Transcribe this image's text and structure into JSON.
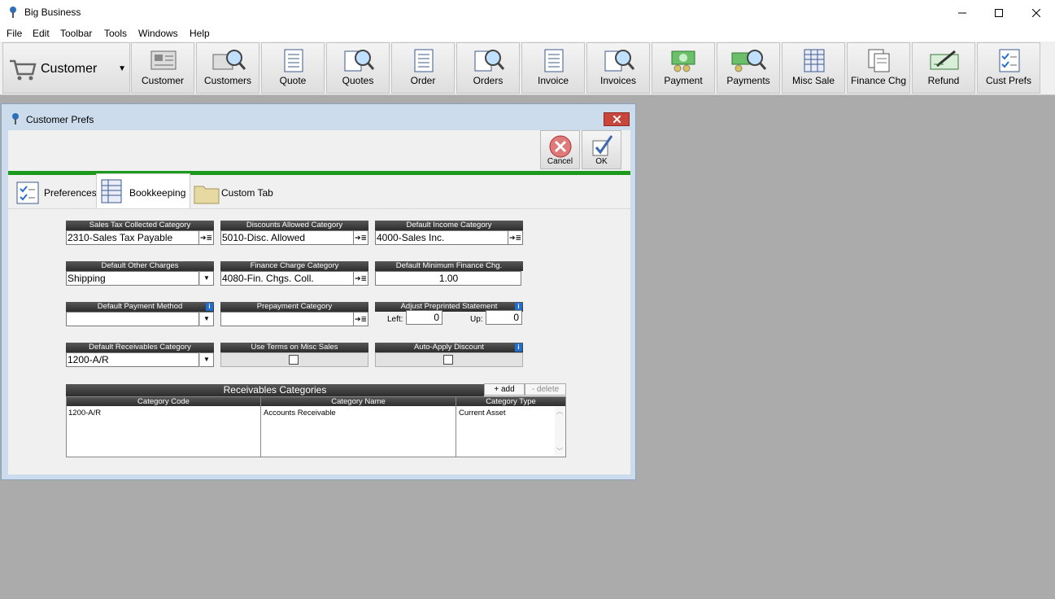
{
  "app": {
    "title": "Big Business"
  },
  "menu": [
    "File",
    "Edit",
    "Toolbar",
    "Tools",
    "Windows",
    "Help"
  ],
  "toolbar": {
    "module": "Customer",
    "buttons": [
      "Customer",
      "Customers",
      "Quote",
      "Quotes",
      "Order",
      "Orders",
      "Invoice",
      "Invoices",
      "Payment",
      "Payments",
      "Misc Sale",
      "Finance Chg",
      "Refund",
      "Cust Prefs"
    ]
  },
  "dialog": {
    "title": "Customer Prefs",
    "cancel_label": "Cancel",
    "ok_label": "OK",
    "tabs": [
      "Preferences",
      "Bookkeeping",
      "Custom Tab"
    ],
    "active_tab": "Bookkeeping",
    "fields": {
      "sales_tax": {
        "label": "Sales Tax Collected Category",
        "value": "2310-Sales Tax Payable"
      },
      "discounts": {
        "label": "Discounts Allowed Category",
        "value": "5010-Disc. Allowed"
      },
      "income": {
        "label": "Default Income Category",
        "value": "4000-Sales Inc."
      },
      "other_charges": {
        "label": "Default Other Charges",
        "value": "Shipping"
      },
      "finance_charge": {
        "label": "Finance Charge Category",
        "value": "4080-Fin. Chgs. Coll."
      },
      "min_finance": {
        "label": "Default Minimum Finance Chg.",
        "value": "1.00"
      },
      "payment_method": {
        "label": "Default Payment Method",
        "value": ""
      },
      "prepayment": {
        "label": "Prepayment Category",
        "value": ""
      },
      "adjust_statement": {
        "label": "Adjust Preprinted Statement",
        "left_label": "Left:",
        "left_value": "0",
        "up_label": "Up:",
        "up_value": "0"
      },
      "receivables": {
        "label": "Default Receivables Category",
        "value": "1200-A/R"
      },
      "use_terms": {
        "label": "Use Terms on Misc Sales",
        "checked": false
      },
      "auto_discount": {
        "label": "Auto-Apply Discount",
        "checked": false
      }
    },
    "grid": {
      "title": "Receivables Categories",
      "add_label": "+ add",
      "delete_label": "- delete",
      "columns": [
        "Category Code",
        "Category Name",
        "Category Type"
      ],
      "rows": [
        [
          "1200-A/R",
          "Accounts Receivable",
          "Current Asset"
        ]
      ]
    }
  }
}
